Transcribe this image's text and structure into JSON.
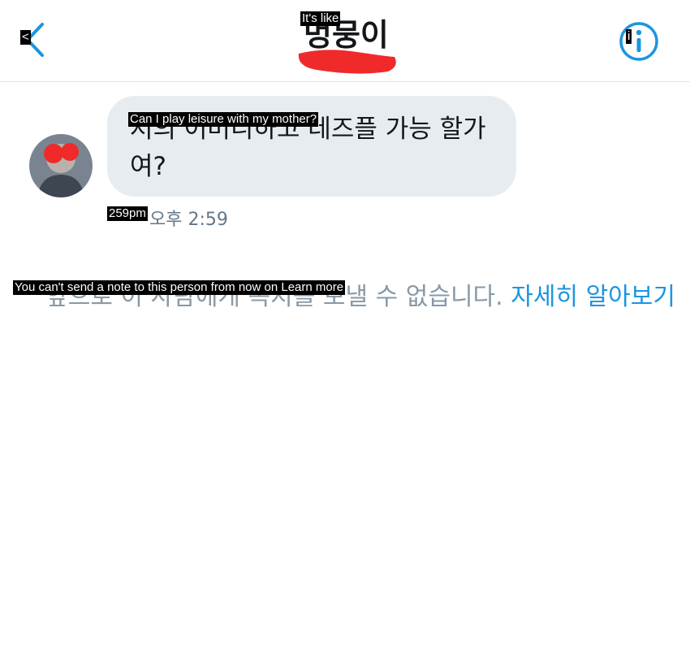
{
  "header": {
    "back_label": "<",
    "title_korean": "멍뭉이",
    "title_overlay": "It's like",
    "info_label": "i"
  },
  "message": {
    "text_korean": "저의 어머니하고 레즈플 가능 할가여?",
    "text_overlay": "Can I play leisure with my mother?",
    "time_korean": "오후 2:59",
    "time_overlay": "259pm"
  },
  "notice": {
    "text_korean": "앞으로 이 사람에게 쪽지를 보낼 수 없습니다.",
    "learn_more_korean": "자세히 알아보기",
    "overlay": "You can't send a note to this person from now on Learn more"
  },
  "colors": {
    "accent": "#1b95e0",
    "bubble": "#e6ecf0",
    "redaction": "#f02a2a",
    "muted": "#8899a6"
  }
}
